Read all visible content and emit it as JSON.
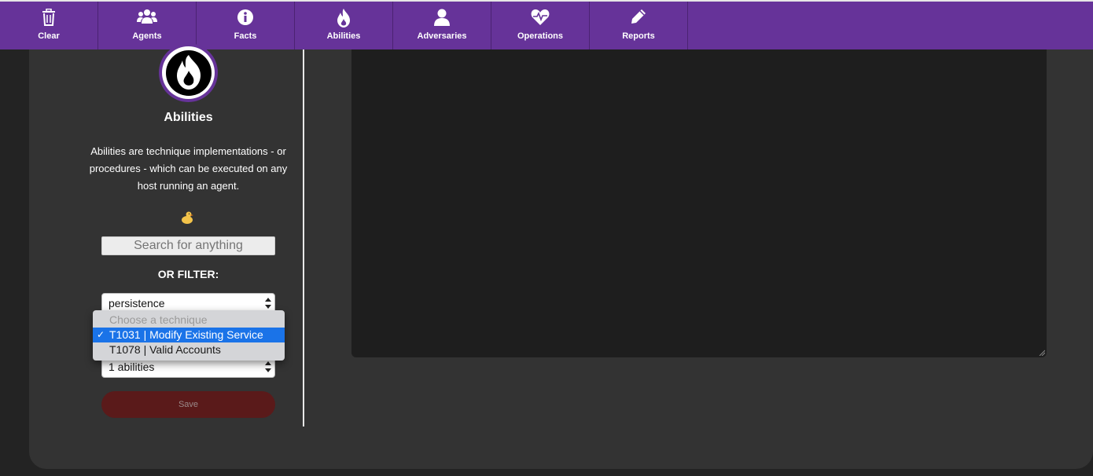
{
  "nav": {
    "items": [
      {
        "label": "Clear",
        "icon": "trash-icon"
      },
      {
        "label": "Agents",
        "icon": "users-icon"
      },
      {
        "label": "Facts",
        "icon": "info-icon"
      },
      {
        "label": "Abilities",
        "icon": "fire-icon"
      },
      {
        "label": "Adversaries",
        "icon": "user-icon"
      },
      {
        "label": "Operations",
        "icon": "heartbeat-icon"
      },
      {
        "label": "Reports",
        "icon": "pencil-icon"
      }
    ],
    "color": "#663399"
  },
  "sidebar": {
    "title": "Abilities",
    "description": "Abilities are technique implementations - or procedures - which can be executed on any host running an agent.",
    "search_placeholder": "Search for anything",
    "filter_label": "OR FILTER:",
    "tactic_select": "persistence",
    "technique_options": [
      "Choose a technique",
      "T1031 | Modify Existing Service",
      "T1078 | Valid Accounts"
    ],
    "technique_selected_index": 1,
    "abilities_select": "1 abilities",
    "save_label": "Save"
  },
  "colors": {
    "background": "#232323",
    "panel": "#333333",
    "editor": "#1e1e1e",
    "save": "#5a1a1a",
    "selection": "#1a73e8"
  }
}
